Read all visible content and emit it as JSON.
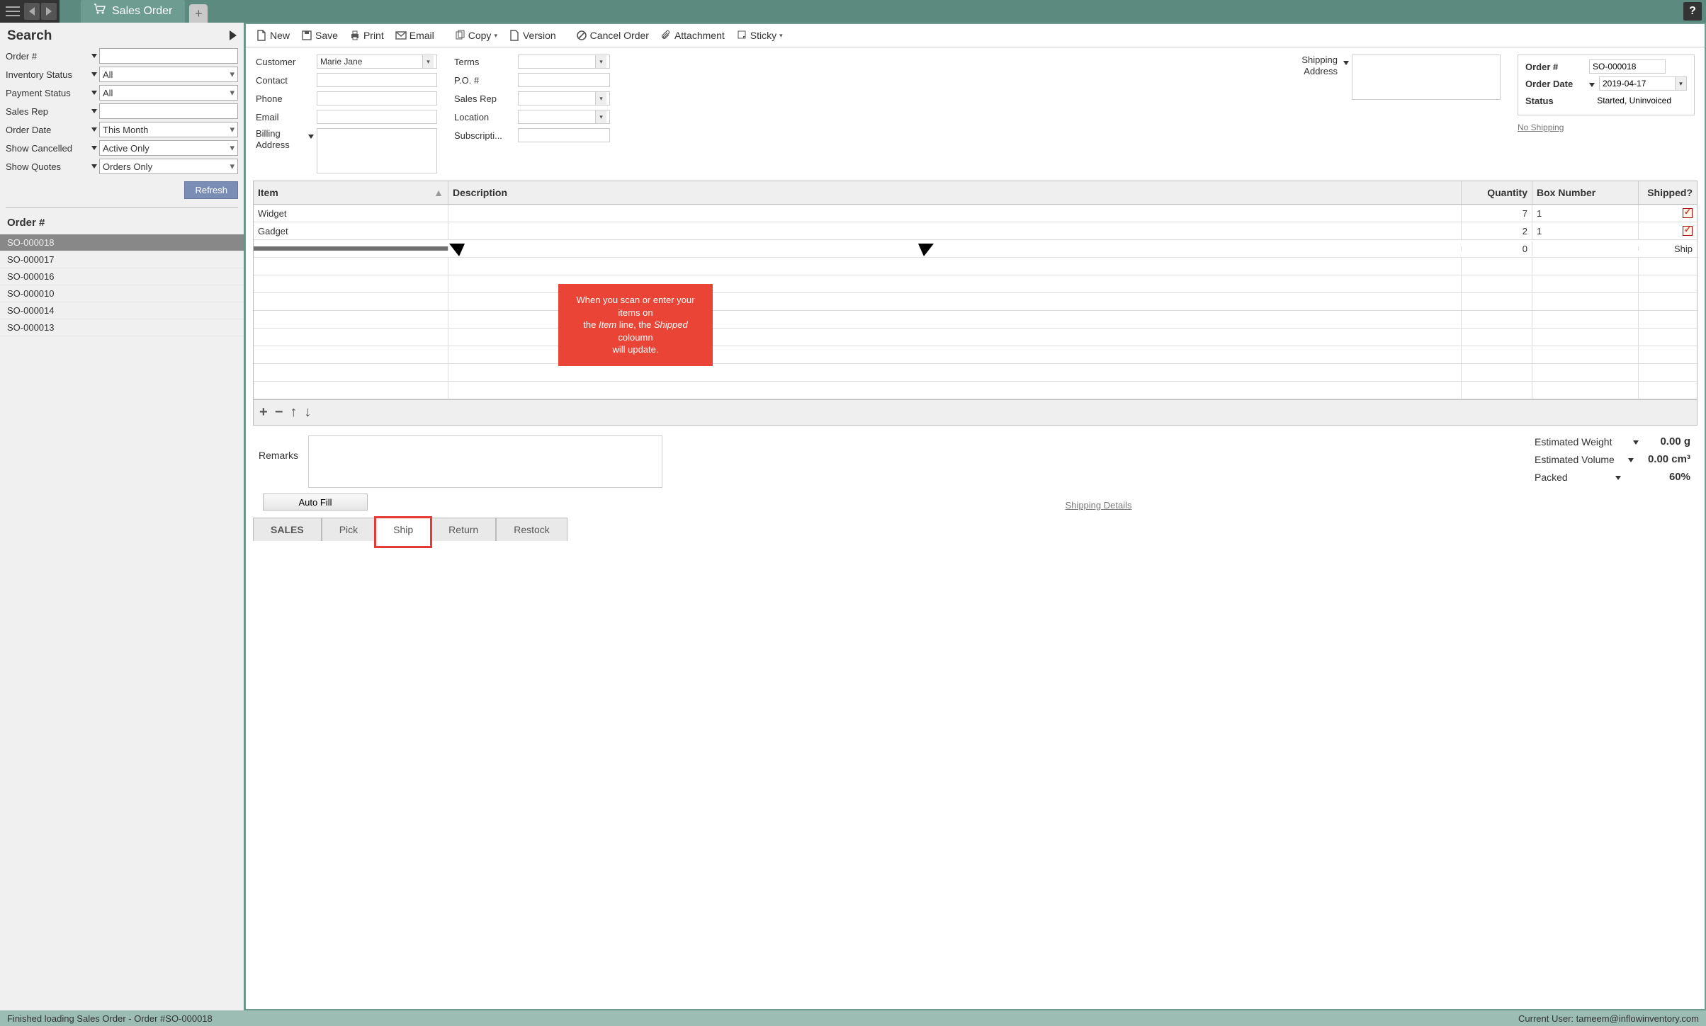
{
  "titlebar": {
    "tab_label": "Sales Order",
    "add_label": "+",
    "help_label": "?"
  },
  "sidebar": {
    "search_title": "Search",
    "fields": {
      "order_no": {
        "label": "Order #",
        "value": ""
      },
      "inventory_status": {
        "label": "Inventory Status",
        "value": "All"
      },
      "payment_status": {
        "label": "Payment Status",
        "value": "All"
      },
      "sales_rep": {
        "label": "Sales Rep",
        "value": ""
      },
      "order_date": {
        "label": "Order Date",
        "value": "This Month"
      },
      "show_cancelled": {
        "label": "Show Cancelled",
        "value": "Active Only"
      },
      "show_quotes": {
        "label": "Show Quotes",
        "value": "Orders Only"
      }
    },
    "refresh_label": "Refresh",
    "list_header": "Order #",
    "orders": [
      "SO-000018",
      "SO-000017",
      "SO-000016",
      "SO-000010",
      "SO-000014",
      "SO-000013"
    ],
    "selected_index": 0
  },
  "toolbar": {
    "new": "New",
    "save": "Save",
    "print": "Print",
    "email": "Email",
    "copy": "Copy",
    "version": "Version",
    "cancel": "Cancel Order",
    "attachment": "Attachment",
    "sticky": "Sticky"
  },
  "form": {
    "customer": {
      "label": "Customer",
      "value": "Marie Jane"
    },
    "contact": {
      "label": "Contact",
      "value": ""
    },
    "phone": {
      "label": "Phone",
      "value": ""
    },
    "email": {
      "label": "Email",
      "value": ""
    },
    "billing": {
      "label": "Billing Address",
      "value": ""
    },
    "terms": {
      "label": "Terms",
      "value": ""
    },
    "po": {
      "label": "P.O. #",
      "value": ""
    },
    "salesrep": {
      "label": "Sales Rep",
      "value": ""
    },
    "location": {
      "label": "Location",
      "value": ""
    },
    "subscription": {
      "label": "Subscripti...",
      "value": ""
    },
    "shipping_addr": {
      "label": "Shipping Address",
      "value": ""
    },
    "no_shipping": "No Shipping"
  },
  "info": {
    "order_no": {
      "label": "Order #",
      "value": "SO-000018"
    },
    "order_date": {
      "label": "Order Date",
      "value": "2019-04-17"
    },
    "status": {
      "label": "Status",
      "value": "Started, Uninvoiced"
    }
  },
  "grid": {
    "headers": {
      "item": "Item",
      "desc": "Description",
      "qty": "Quantity",
      "box": "Box Number",
      "shipped": "Shipped?"
    },
    "rows": [
      {
        "item": "Widget",
        "desc": "",
        "qty": "7",
        "box": "1",
        "shipped": true
      },
      {
        "item": "Gadget",
        "desc": "",
        "qty": "2",
        "box": "1",
        "shipped": true
      },
      {
        "item": "",
        "desc": "",
        "qty": "0",
        "box": "",
        "shipped_label": "Ship"
      }
    ]
  },
  "remarks_label": "Remarks",
  "autofill_label": "Auto Fill",
  "shipping_details": "Shipping Details",
  "summary": {
    "weight": {
      "label": "Estimated Weight",
      "value": "0.00 g"
    },
    "volume": {
      "label": "Estimated Volume",
      "value": "0.00 cm³"
    },
    "packed": {
      "label": "Packed",
      "value": "60%"
    }
  },
  "bottom_tabs": {
    "sales": "SALES",
    "pick": "Pick",
    "ship": "Ship",
    "return": "Return",
    "restock": "Restock"
  },
  "statusbar": {
    "left": "Finished loading Sales Order - Order #SO-000018",
    "right": "Current User:  tameem@inflowinventory.com"
  },
  "callout": {
    "line1": "When you scan or enter your items on",
    "line2_a": "the ",
    "line2_item": "Item",
    "line2_b": "  line, the ",
    "line2_shipped": "Shipped",
    "line2_c": " coloumn",
    "line3": "will update."
  }
}
